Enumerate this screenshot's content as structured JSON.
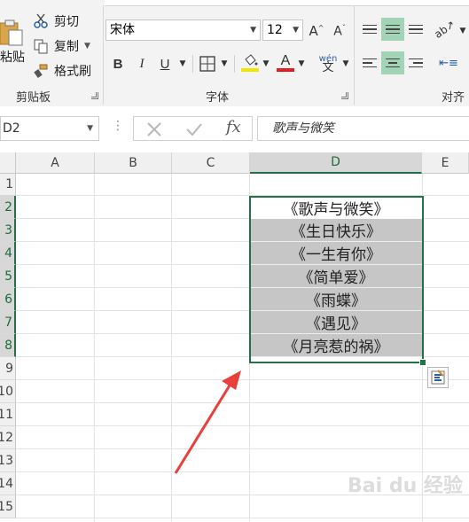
{
  "ribbon": {
    "clipboard": {
      "paste_label": "粘贴",
      "cut_label": "剪切",
      "copy_label": "复制",
      "format_painter_label": "格式刷",
      "group_label": "剪贴板"
    },
    "font": {
      "font_name": "宋体",
      "font_size": "12",
      "bold": "B",
      "italic": "I",
      "underline": "U",
      "group_label": "字体",
      "font_color": "#e02020",
      "highlight_color": "#f2e600"
    },
    "alignment": {
      "group_label": "对齐"
    }
  },
  "formula_bar": {
    "name_box": "D2",
    "formula": "歌声与微笑"
  },
  "sheet": {
    "columns": [
      "A",
      "B",
      "C",
      "D",
      "E"
    ],
    "active_column": "D",
    "rows": [
      "1",
      "2",
      "3",
      "4",
      "5",
      "6",
      "7",
      "8",
      "9",
      "10",
      "11",
      "12",
      "13",
      "14",
      "15"
    ],
    "cells_d": [
      "《歌声与微笑》",
      "《生日快乐》",
      "《一生有你》",
      "《简单爱》",
      "《雨蝶》",
      "《遇见》",
      "《月亮惹的祸》"
    ]
  },
  "colors": {
    "accent": "#217346",
    "selection": "#c6c6c6",
    "arrow": "#e8403a"
  },
  "watermark": "Bai du 经验"
}
